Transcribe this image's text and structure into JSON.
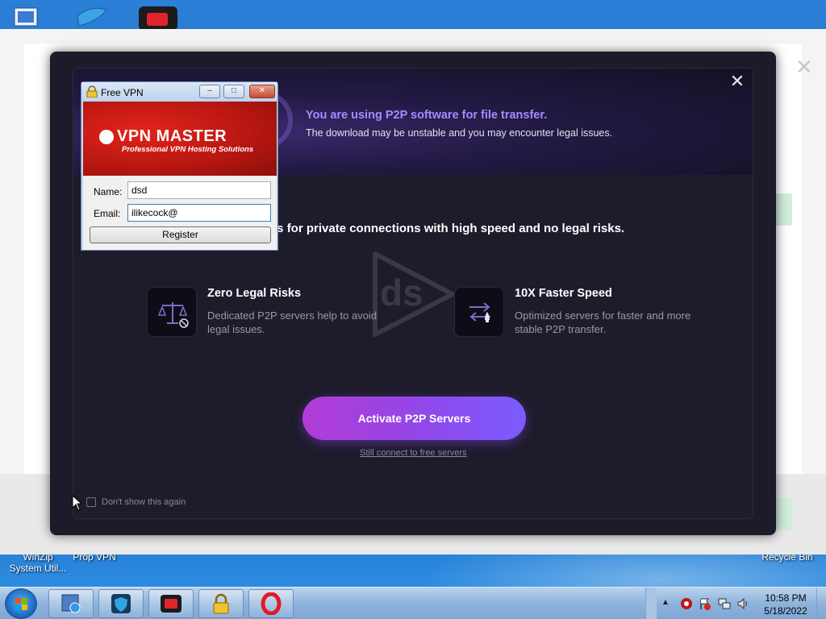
{
  "desktop": {
    "labels": {
      "winzip_line1": "WinZip",
      "winzip_line2": "System Util...",
      "vpn": "Prop VPN",
      "recycle": "Recycle Bin"
    }
  },
  "modal": {
    "header_title": "You are using P2P software for file transfer.",
    "header_subtitle": "The download may be unstable and you may encounter legal issues.",
    "headline": "ers for private connections with high speed and no legal risks.",
    "features": [
      {
        "title": "Zero Legal Risks",
        "desc_line1": "Dedicated P2P servers help to avoid",
        "desc_line2": "legal issues.",
        "icon": "scale-icon"
      },
      {
        "title": "10X Faster Speed",
        "desc_line1": "Optimized servers for faster and more",
        "desc_line2": "stable P2P transfer.",
        "icon": "rocket-swap-icon"
      }
    ],
    "activate_label": "Activate P2P Servers",
    "free_link": "Still connect to free servers",
    "dont_show": "Don't show this again",
    "watermark": "ds",
    "accent_color": "#a58bff"
  },
  "vpn_window": {
    "title": "Free VPN",
    "brand": "VPN MASTER",
    "tagline": "Professional VPN Hosting Solutions",
    "name_label": "Name:",
    "name_value": "dsd",
    "email_label": "Email:",
    "email_value": "ilikecock@",
    "register_label": "Register",
    "btn_minimize": "–",
    "btn_maximize": "□",
    "btn_close": "✕"
  },
  "taskbar": {
    "time": "10:58 PM",
    "date": "5/18/2022"
  }
}
